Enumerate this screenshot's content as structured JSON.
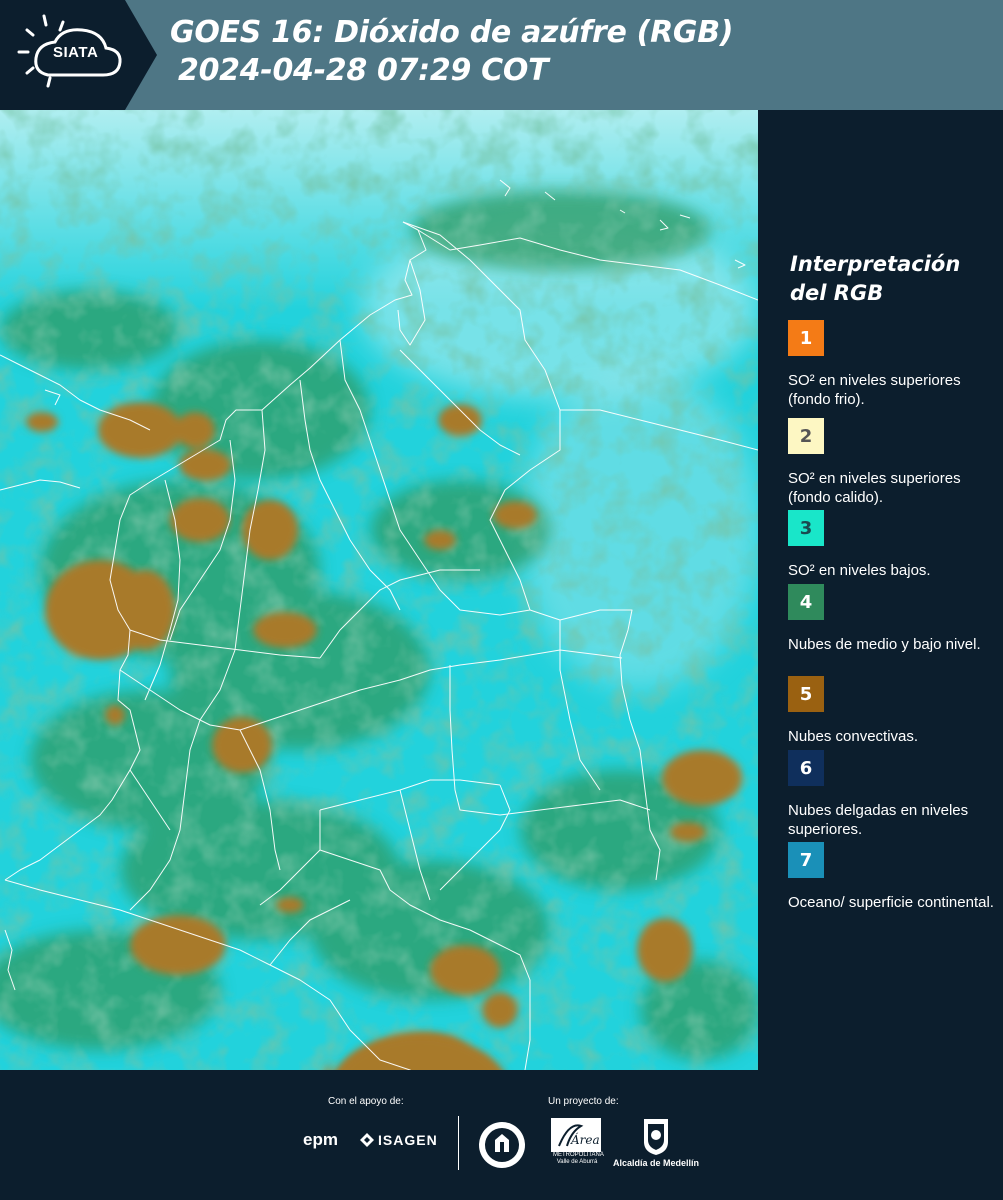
{
  "header": {
    "logo_text": "SIATA",
    "title_line1": "GOES 16: Dióxido de azúfre (RGB)",
    "title_line2": "2024-04-28 07:29 COT"
  },
  "legend": {
    "title": "Interpretación del RGB",
    "items": [
      {
        "number": "1",
        "color": "#f47b16",
        "text_color": "#ffffff",
        "text": "SO² en niveles superiores (fondo frio)."
      },
      {
        "number": "2",
        "color": "#fdf7c3",
        "text_color": "#555555",
        "text": "SO² en niveles superiores (fondo calido)."
      },
      {
        "number": "3",
        "color": "#19e6c9",
        "text_color": "#1a4a50",
        "text": "SO² en niveles bajos."
      },
      {
        "number": "4",
        "color": "#2f8a5c",
        "text_color": "#ffffff",
        "text": "Nubes de medio y bajo nivel."
      },
      {
        "number": "5",
        "color": "#9a6111",
        "text_color": "#ffffff",
        "text": "Nubes convectivas."
      },
      {
        "number": "6",
        "color": "#0f2f5c",
        "text_color": "#ffffff",
        "text": "Nubes delgadas en niveles superiores."
      },
      {
        "number": "7",
        "color": "#1a90b8",
        "text_color": "#ffffff",
        "text": "Oceano/ superficie continental."
      }
    ]
  },
  "footer": {
    "support_label": "Con el apoyo de:",
    "project_label": "Un proyecto de:",
    "sponsor_1": "epm",
    "sponsor_2": "ISAGEN",
    "partner_area": "Área",
    "partner_area_caption": "METROPOLITANA Valle de Aburrá",
    "partner_alcaldia": "Alcaldía de Medellín"
  },
  "map": {
    "colors": {
      "background": "#22d2dc",
      "land_green": "#2e9a62",
      "convective": "#a87a2c",
      "borders": "#ffffff"
    }
  }
}
